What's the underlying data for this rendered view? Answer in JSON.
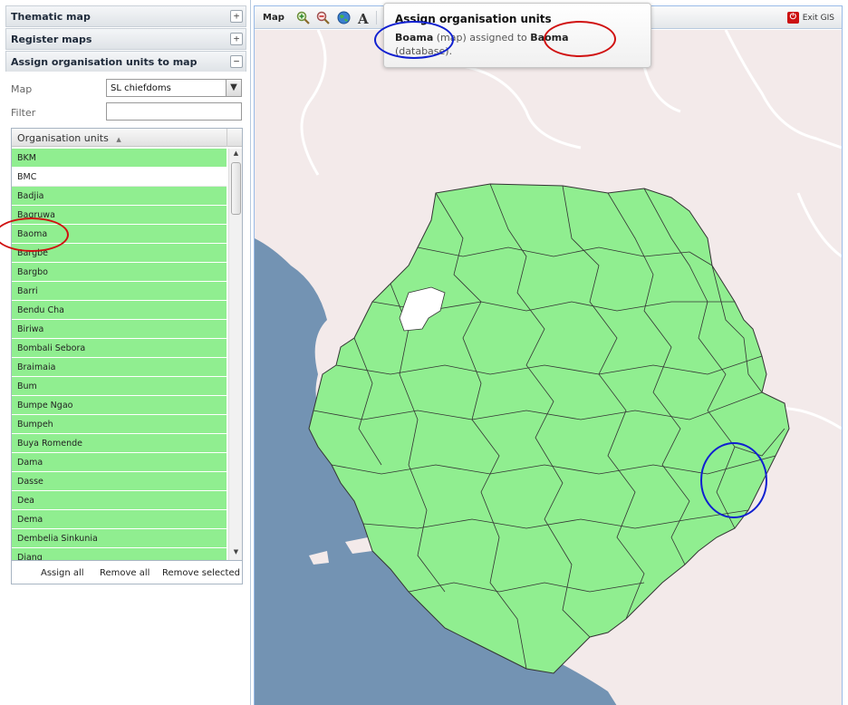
{
  "accordion": {
    "thematic_map": "Thematic map",
    "register_maps": "Register maps",
    "assign_units": "Assign organisation units to map"
  },
  "form": {
    "map_label": "Map",
    "map_value": "SL chiefdoms",
    "filter_label": "Filter",
    "filter_value": ""
  },
  "grid": {
    "column": "Organisation units",
    "rows": [
      {
        "label": "BKM",
        "assigned": true
      },
      {
        "label": "BMC",
        "assigned": false
      },
      {
        "label": "Badjia",
        "assigned": true
      },
      {
        "label": "Bagruwa",
        "assigned": true
      },
      {
        "label": "Baoma",
        "assigned": true
      },
      {
        "label": "Bargbe",
        "assigned": true
      },
      {
        "label": "Bargbo",
        "assigned": true
      },
      {
        "label": "Barri",
        "assigned": true
      },
      {
        "label": "Bendu Cha",
        "assigned": true
      },
      {
        "label": "Biriwa",
        "assigned": true
      },
      {
        "label": "Bombali Sebora",
        "assigned": true
      },
      {
        "label": "Braimaia",
        "assigned": true
      },
      {
        "label": "Bum",
        "assigned": true
      },
      {
        "label": "Bumpe Ngao",
        "assigned": true
      },
      {
        "label": "Bumpeh",
        "assigned": true
      },
      {
        "label": "Buya Romende",
        "assigned": true
      },
      {
        "label": "Dama",
        "assigned": true
      },
      {
        "label": "Dasse",
        "assigned": true
      },
      {
        "label": "Dea",
        "assigned": true
      },
      {
        "label": "Dema",
        "assigned": true
      },
      {
        "label": "Dembelia Sinkunia",
        "assigned": true
      },
      {
        "label": "Diang",
        "assigned": true
      }
    ],
    "assign_all": "Assign all",
    "remove_all": "Remove all",
    "remove_selected": "Remove selected"
  },
  "map_panel": {
    "title": "Map",
    "exit": "Exit GIS",
    "icons": [
      "zoom-in-icon",
      "zoom-out-icon",
      "globe-icon",
      "label-icon"
    ]
  },
  "tooltip": {
    "title": "Assign organisation units",
    "map_unit": "Boama",
    "text_mid": "(map) assigned to",
    "db_unit": "Baoma",
    "text_end": "(database)."
  },
  "colors": {
    "assigned": "#90ee90",
    "sea": "#7393b3",
    "land": "#f3eaea",
    "highlight_red": "#d01010",
    "highlight_blue": "#1020d0"
  }
}
